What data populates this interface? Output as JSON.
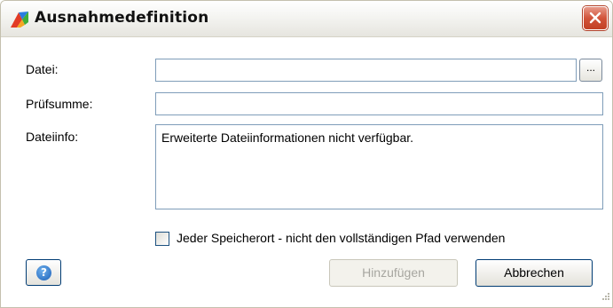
{
  "window": {
    "title": "Ausnahmedefinition"
  },
  "form": {
    "file_label": "Datei:",
    "file_value": "",
    "browse_label": "...",
    "checksum_label": "Prüfsumme:",
    "checksum_value": "",
    "fileinfo_label": "Dateiinfo:",
    "fileinfo_value": "Erweiterte Dateiinformationen nicht verfügbar.",
    "any_location_label": "Jeder Speicherort - nicht den vollständigen Pfad verwenden",
    "any_location_checked": false
  },
  "buttons": {
    "help_label": "?",
    "add_label": "Hinzufügen",
    "add_enabled": false,
    "cancel_label": "Abbrechen"
  },
  "colors": {
    "body_background": "#ffffff",
    "field_border": "#7f9db9",
    "close_red": "#d2533a",
    "disabled_text": "#a7a6a0"
  },
  "icons": {
    "app": "avg-logo-icon",
    "close": "close-icon",
    "help": "help-icon",
    "resize": "resize-grip-icon"
  }
}
